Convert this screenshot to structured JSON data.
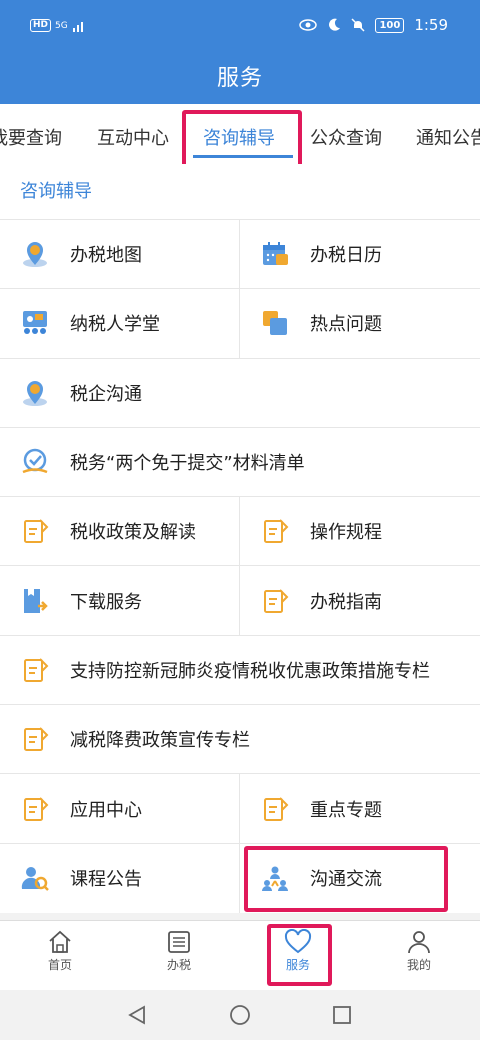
{
  "status": {
    "hd": "HD",
    "net": "5G",
    "time": "1:59",
    "battery": "100"
  },
  "header": {
    "title": "服务"
  },
  "tabs": [
    "我要查询",
    "互动中心",
    "咨询辅导",
    "公众查询",
    "通知公告"
  ],
  "section": {
    "title": "咨询辅导"
  },
  "items": [
    {
      "label": "办税地图",
      "icon": "map-pin-tax-icon"
    },
    {
      "label": "办税日历",
      "icon": "calendar-tax-icon"
    },
    {
      "label": "纳税人学堂",
      "icon": "classroom-icon"
    },
    {
      "label": "热点问题",
      "icon": "hot-questions-icon"
    },
    {
      "label": "税企沟通",
      "icon": "map-pin-tax-icon"
    },
    {
      "label": "税务“两个免于提交”材料清单",
      "icon": "check-hand-icon"
    },
    {
      "label": "税收政策及解读",
      "icon": "document-edit-icon"
    },
    {
      "label": "操作规程",
      "icon": "document-edit-icon"
    },
    {
      "label": "下载服务",
      "icon": "download-doc-icon"
    },
    {
      "label": "办税指南",
      "icon": "document-edit-icon"
    },
    {
      "label": "支持防控新冠肺炎疫情税收优惠政策措施专栏",
      "icon": "document-edit-icon"
    },
    {
      "label": "减税降费政策宣传专栏",
      "icon": "document-edit-icon"
    },
    {
      "label": "应用中心",
      "icon": "document-edit-icon"
    },
    {
      "label": "重点专题",
      "icon": "document-edit-icon"
    },
    {
      "label": "课程公告",
      "icon": "user-search-icon"
    },
    {
      "label": "沟通交流",
      "icon": "group-icon"
    }
  ],
  "bottom_nav": [
    {
      "label": "首页",
      "icon": "home-icon"
    },
    {
      "label": "办税",
      "icon": "list-icon"
    },
    {
      "label": "服务",
      "icon": "heart-icon"
    },
    {
      "label": "我的",
      "icon": "person-icon"
    }
  ],
  "colors": {
    "primary": "#3d85d8",
    "highlight": "#e0195a",
    "accent": "#f0a830"
  }
}
